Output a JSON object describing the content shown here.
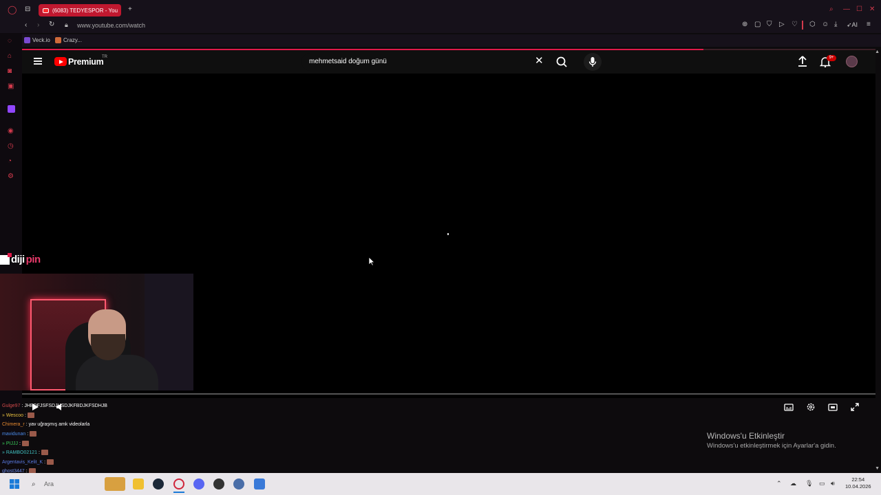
{
  "browser": {
    "tab_title": "(6083) TEDYESPOR - You",
    "new_tab": "+",
    "url": "www.youtube.com/watch",
    "bookmarks": [
      {
        "label": "Veck.io"
      },
      {
        "label": "Crazy..."
      }
    ],
    "ai_label": "AI"
  },
  "youtube": {
    "logo_text": "Premium",
    "region": "TR",
    "search_value": "mehmetsaid doğum günü",
    "notification_badge": "9+",
    "playback_progress_fraction": 0.0
  },
  "overlay": {
    "brand_left": "diji",
    "brand_right": "pin"
  },
  "chat": [
    {
      "user": "Gulge97",
      "user_color": "#d24a4a",
      "text": ": JHBDFJSFSDJHSDJKFBDJKFSDHJB",
      "emote": false
    },
    {
      "user": "» Wescoo",
      "user_color": "#e8c040",
      "text": ":",
      "emote": true
    },
    {
      "user": "Chimera_r",
      "user_color": "#e88a30",
      "text": ": yav uğraşmış amk videolarla",
      "emote": false
    },
    {
      "user": "mavidunan",
      "user_color": "#4a8ae8",
      "text": ":",
      "emote": true
    },
    {
      "user": "» PIJJJ",
      "user_color": "#3acc5a",
      "text": ":",
      "emote": true
    },
    {
      "user": "» RAMBO02121",
      "user_color": "#40c0c0",
      "text": ":",
      "emote": true
    },
    {
      "user": "Argentavis_Kelit_K",
      "user_color": "#5a7ae0",
      "text": ":",
      "emote": true
    },
    {
      "user": "ghost3447",
      "user_color": "#6a8ae8",
      "text": ":",
      "emote": true
    }
  ],
  "windows": {
    "activate_title": "Windows'u Etkinleştir",
    "activate_sub": "Windows'u etkinleştirmek için Ayarlar'a gidin.",
    "search_placeholder": "Ara",
    "time": "22:54",
    "date": "10.04.2026"
  },
  "colors": {
    "accent": "#e0194a",
    "youtube_red": "#ff0000"
  }
}
